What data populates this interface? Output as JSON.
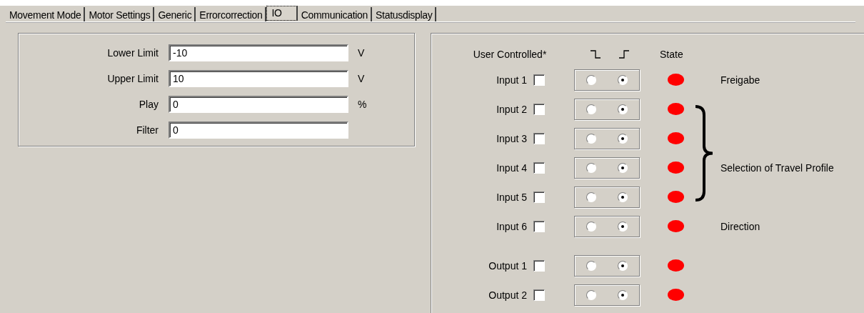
{
  "tabs": [
    {
      "label": "Movement Mode",
      "selected": false
    },
    {
      "label": "Motor Settings",
      "selected": false
    },
    {
      "label": "Generic",
      "selected": false
    },
    {
      "label": "Errorcorrection",
      "selected": false
    },
    {
      "label": "IO",
      "selected": true
    },
    {
      "label": "Communication",
      "selected": false
    },
    {
      "label": "Statusdisplay",
      "selected": false
    }
  ],
  "limits": [
    {
      "label": "Lower Limit",
      "value": "-10",
      "unit": "V"
    },
    {
      "label": "Upper Limit",
      "value": "10",
      "unit": "V"
    },
    {
      "label": "Play",
      "value": "0",
      "unit": "%"
    },
    {
      "label": "Filter",
      "value": "0"
    }
  ],
  "io": {
    "header": {
      "user_controlled": "User Controlled*",
      "state": "State"
    },
    "inputs": [
      {
        "label": "Input 1",
        "checked": false,
        "radios": [
          {
            "selected": false
          },
          {
            "selected": true
          }
        ],
        "color": "#ff0000",
        "note": "Freigabe",
        "braced": false
      },
      {
        "label": "Input 2",
        "checked": false,
        "radios": [
          {
            "selected": false
          },
          {
            "selected": true
          }
        ],
        "color": "#ff0000",
        "braced": true
      },
      {
        "label": "Input 3",
        "checked": false,
        "radios": [
          {
            "selected": false
          },
          {
            "selected": true
          }
        ],
        "color": "#ff0000",
        "braced": true
      },
      {
        "label": "Input 4",
        "checked": false,
        "radios": [
          {
            "selected": false
          },
          {
            "selected": true
          }
        ],
        "color": "#ff0000",
        "note": "Selection of Travel Profile",
        "braced": true
      },
      {
        "label": "Input 5",
        "checked": false,
        "radios": [
          {
            "selected": false
          },
          {
            "selected": true
          }
        ],
        "color": "#ff0000",
        "braced": true
      },
      {
        "label": "Input 6",
        "checked": false,
        "radios": [
          {
            "selected": false
          },
          {
            "selected": true
          }
        ],
        "color": "#ff0000",
        "note": "Direction",
        "braced": false
      }
    ],
    "outputs": [
      {
        "label": "Output 1",
        "checked": false,
        "radios": [
          {
            "selected": false
          },
          {
            "selected": true
          }
        ],
        "color": "#ff0000",
        "braced": false
      },
      {
        "label": "Output 2",
        "checked": false,
        "radios": [
          {
            "selected": false
          },
          {
            "selected": true
          }
        ],
        "color": "#ff0000",
        "braced": false
      }
    ]
  }
}
